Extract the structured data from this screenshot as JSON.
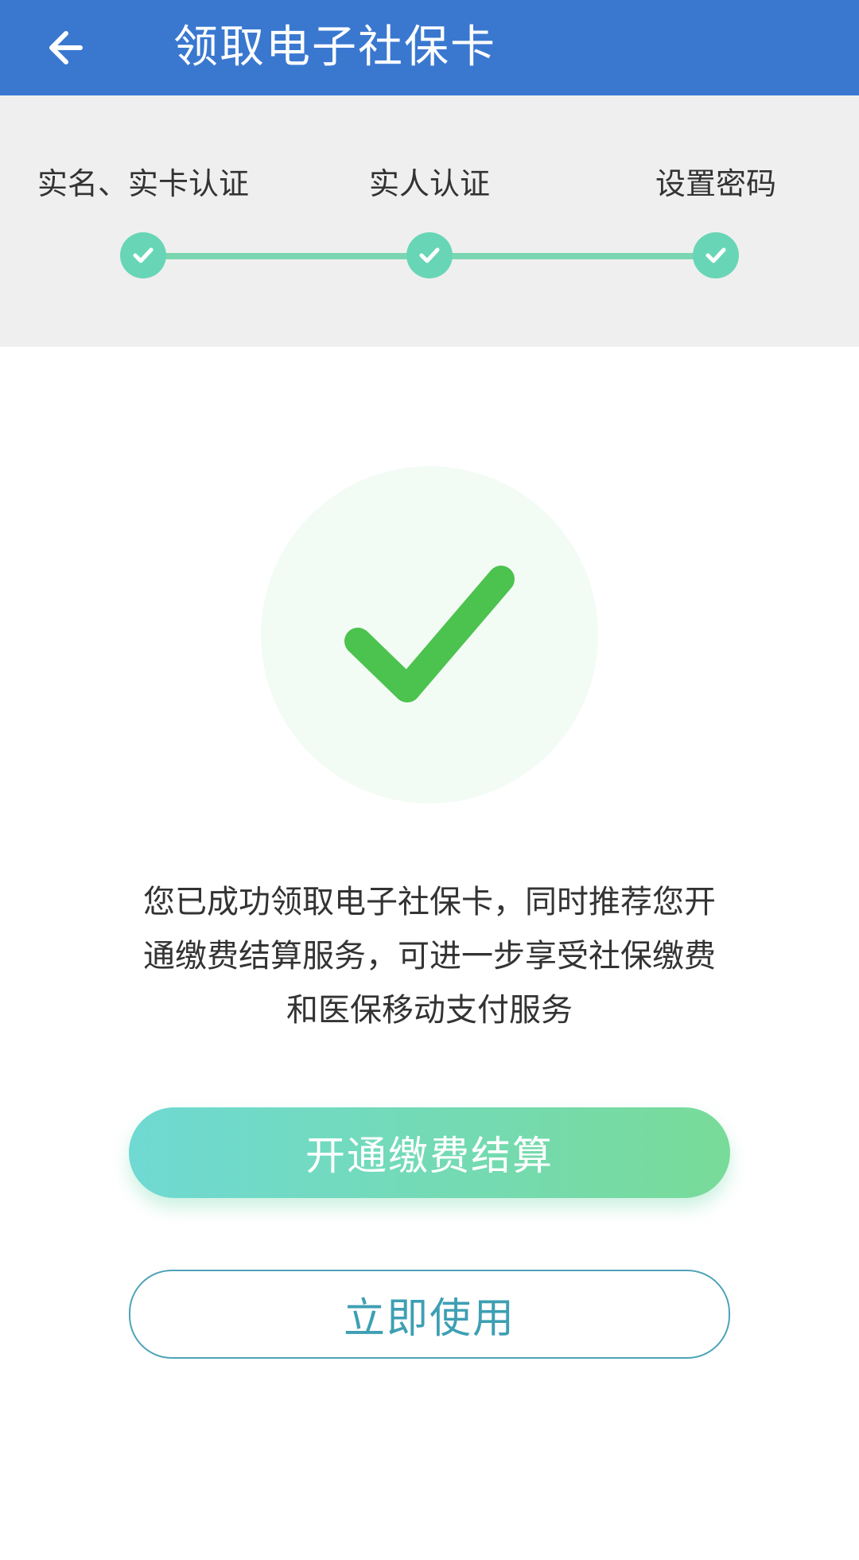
{
  "app_bar": {
    "title": "领取电子社保卡",
    "back_icon": "arrow-left-icon",
    "color": "#3a78d0"
  },
  "steps": {
    "items": [
      {
        "label": "实名、实卡认证",
        "status": "completed"
      },
      {
        "label": "实人认证",
        "status": "completed"
      },
      {
        "label": "设置密码",
        "status": "completed"
      }
    ],
    "accent_color": "#68d6b6"
  },
  "result": {
    "icon": "check-icon",
    "icon_color": "#4cc24f",
    "message": "您已成功领取电子社保卡，同时推荐您开通缴费结算服务，可进一步享受社保缴费和医保移动支付服务"
  },
  "actions": {
    "primary_label": "开通缴费结算",
    "secondary_label": "立即使用"
  }
}
